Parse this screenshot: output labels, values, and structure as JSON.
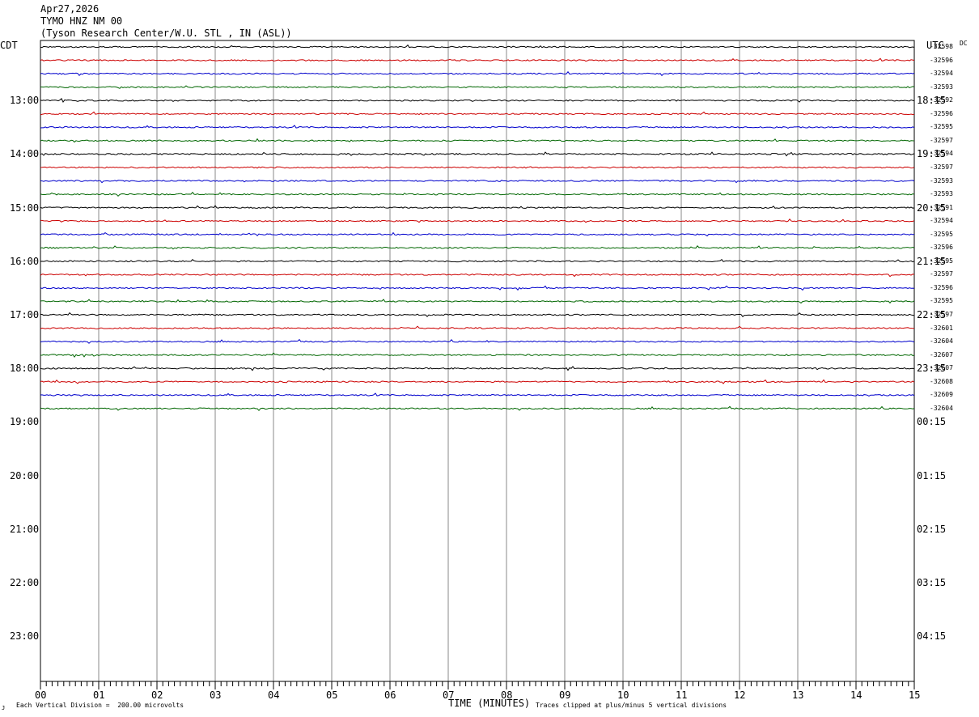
{
  "header": {
    "date": "Apr27,2026",
    "station": "TYMO HNZ NM 00",
    "location": "(Tyson Research Center/W.U. STL , IN (ASL))"
  },
  "left_zone": "CDT",
  "right_zone": "UTC",
  "dc_label": "DC",
  "footer": {
    "mark": "J",
    "scale_note": "Each Vertical Division =  200.00 microvolts",
    "xlabel": "TIME (MINUTES)",
    "clip_note": "Traces clipped at plus/minus 5 vertical divisions"
  },
  "chart_data": {
    "type": "line",
    "title": "TYMO HNZ NM 00",
    "xlabel": "TIME (MINUTES)",
    "x_ticks": [
      "00",
      "01",
      "02",
      "03",
      "04",
      "05",
      "06",
      "07",
      "08",
      "09",
      "10",
      "11",
      "12",
      "13",
      "14",
      "15"
    ],
    "xlim": [
      0,
      15
    ],
    "left_hour_labels": [
      "13:00",
      "14:00",
      "15:00",
      "16:00",
      "17:00",
      "18:00",
      "19:00",
      "20:00",
      "21:00",
      "22:00",
      "23:00"
    ],
    "right_hour_labels": [
      "18:15",
      "19:15",
      "20:15",
      "21:15",
      "22:15",
      "23:15",
      "00:15",
      "01:15",
      "02:15",
      "03:15",
      "04:15"
    ],
    "trace_colors": [
      "#000000",
      "#cc0000",
      "#0000cc",
      "#006600"
    ],
    "traces_recorded": 28,
    "dc_offsets": [
      "-32598",
      "-32596",
      "-32594",
      "-32593",
      "-32592",
      "-32596",
      "-32595",
      "-32597",
      "-32594",
      "-32597",
      "-32593",
      "-32593",
      "-32591",
      "-32594",
      "-32595",
      "-32596",
      "-32595",
      "-32597",
      "-32596",
      "-32595",
      "-32597",
      "-32601",
      "-32604",
      "-32607",
      "-32607",
      "-32608",
      "-32609",
      "-32604"
    ],
    "grid": true
  }
}
